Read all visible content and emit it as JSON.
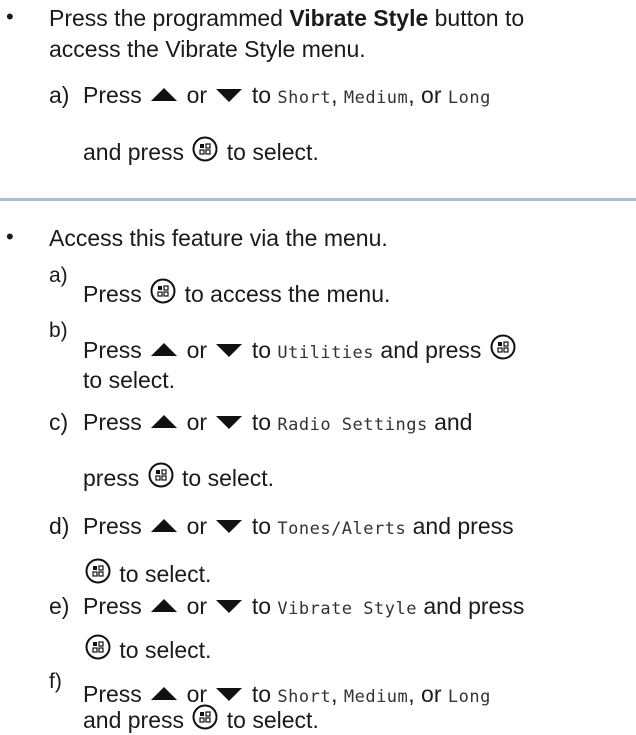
{
  "section1": {
    "bullet": "•",
    "intro_pre": "Press the programmed ",
    "intro_bold": "Vibrate Style",
    "intro_post": " button to",
    "intro_line2": "access the Vibrate Style menu.",
    "step_a": {
      "letter": "a)",
      "press": "Press",
      "or": "or",
      "to": "to",
      "opt_short": "Short",
      "comma1": ",",
      "opt_medium": "Medium",
      "or2": ", or",
      "opt_long": "Long",
      "line2_pre": "and press",
      "line2_post": "to select."
    }
  },
  "section2": {
    "bullet": "•",
    "intro": "Access this feature via the menu.",
    "steps": {
      "a": {
        "letter": "a)",
        "pre": "Press",
        "post": "to access the menu."
      },
      "b": {
        "letter": "b)",
        "pre": "Press",
        "or": "or",
        "to": "to",
        "mono": "Utilities",
        "post": "and press",
        "line2": "to select."
      },
      "c": {
        "letter": "c)",
        "pre": "Press",
        "or": "or",
        "to": "to",
        "mono": "Radio Settings",
        "post": "and",
        "line2_pre": "press",
        "line2_post": "to select."
      },
      "d": {
        "letter": "d)",
        "pre": "Press",
        "or": "or",
        "to": "to",
        "mono": "Tones/Alerts",
        "post": "and press",
        "line2_post": "to select."
      },
      "e": {
        "letter": "e)",
        "pre": "Press",
        "or": "or",
        "to": "to",
        "mono": "Vibrate Style",
        "post": "and press",
        "line2_post": "to select."
      },
      "f": {
        "letter": "f)",
        "pre": "Press",
        "or": "or",
        "to": "to",
        "opt_short": "Short",
        "comma1": ",",
        "opt_medium": "Medium",
        "or2": ", or",
        "opt_long": "Long",
        "line2_pre": "and press",
        "line2_post": "to select."
      }
    }
  },
  "icons": {
    "up": "up-arrow-icon",
    "down": "down-arrow-icon",
    "menu_ok": "menu-ok-button-icon"
  }
}
